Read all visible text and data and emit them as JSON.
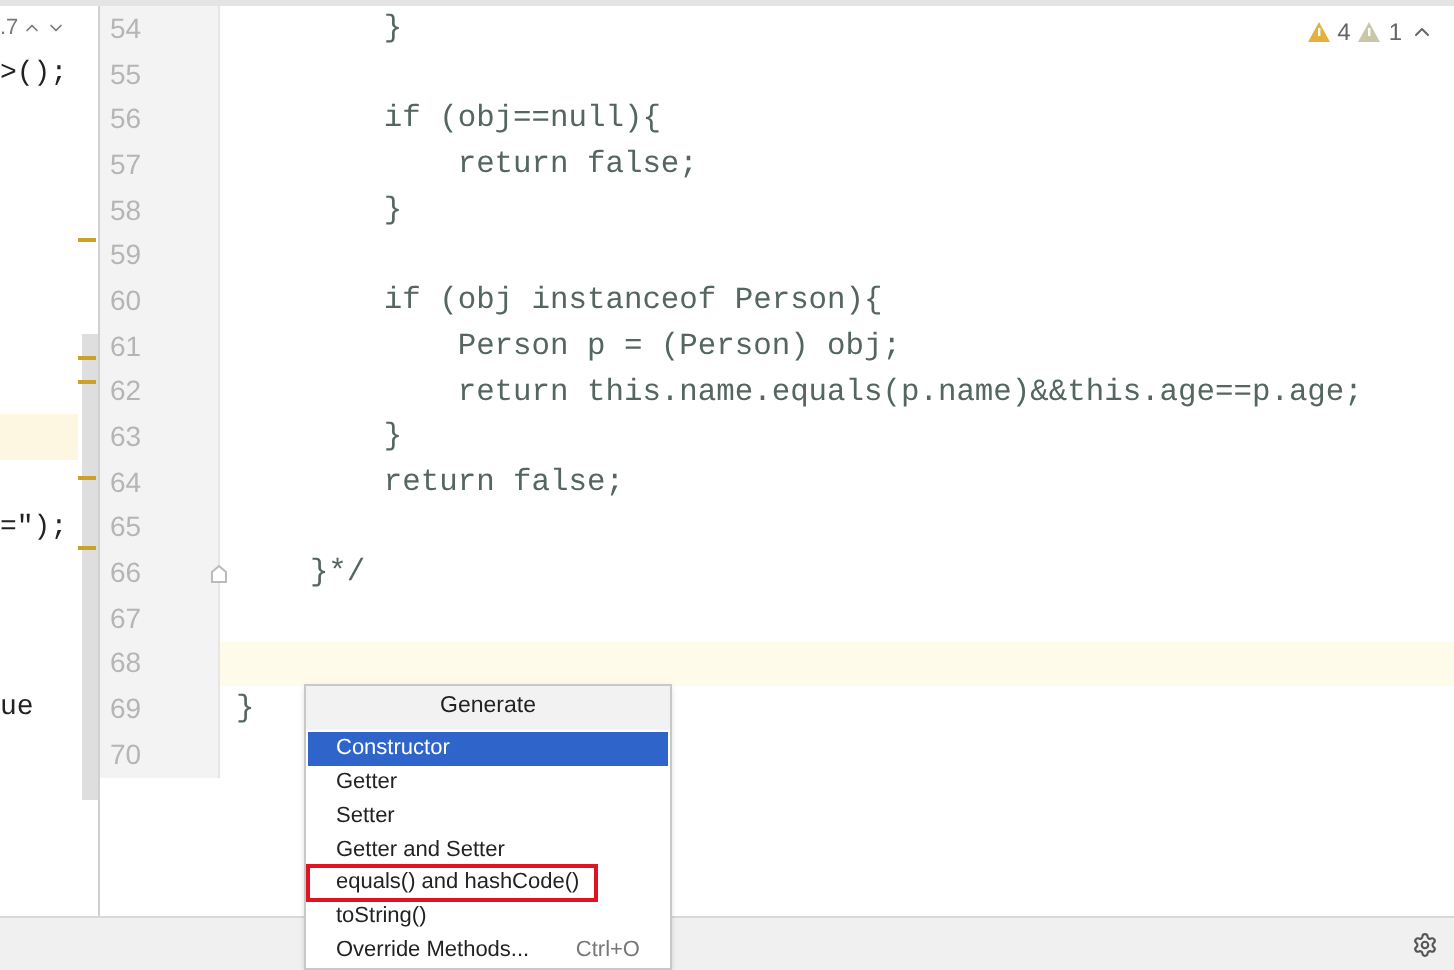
{
  "left_pane": {
    "problem_count": ".7",
    "lines": [
      {
        "text": ">();",
        "current": false
      },
      {
        "current": false
      },
      {
        "current": false
      },
      {
        "current": false
      },
      {
        "current": false
      },
      {
        "current": false
      },
      {
        "current": false
      },
      {
        "current": false
      },
      {
        "current": true
      },
      {
        "current": false
      },
      {
        "text": "=\");",
        "current": false
      },
      {
        "current": false
      },
      {
        "current": false
      },
      {
        "current": false
      },
      {
        "text": "ue",
        "current": false
      },
      {
        "current": false
      }
    ]
  },
  "editor": {
    "warnings": {
      "warning_count": "4",
      "weak_warning_count": "1"
    },
    "lines": [
      {
        "number": "54",
        "code": "        }",
        "current": false
      },
      {
        "number": "55",
        "current": false
      },
      {
        "number": "56",
        "code": "        if (obj==null){",
        "current": false
      },
      {
        "number": "57",
        "code": "            return false;",
        "current": false
      },
      {
        "number": "58",
        "code": "        }",
        "current": false
      },
      {
        "number": "59",
        "current": false
      },
      {
        "number": "60",
        "code": "        if (obj instanceof Person){",
        "current": false
      },
      {
        "number": "61",
        "code": "            Person p = (Person) obj;",
        "current": false
      },
      {
        "number": "62",
        "code": "            return this.name.equals(p.name)&&this.age==p.age;",
        "current": false
      },
      {
        "number": "63",
        "code": "        }",
        "current": false
      },
      {
        "number": "64",
        "code": "        return false;",
        "current": false
      },
      {
        "number": "65",
        "current": false
      },
      {
        "number": "66",
        "code": "    }*/",
        "current": false,
        "fold": true
      },
      {
        "number": "67",
        "current": false
      },
      {
        "number": "68",
        "current": true
      },
      {
        "number": "69",
        "code": "}",
        "current": false
      },
      {
        "number": "70",
        "current": false
      }
    ]
  },
  "generate_popup": {
    "title": "Generate",
    "items": [
      {
        "label": "Constructor",
        "selected": true,
        "annotated": false
      },
      {
        "label": "Getter",
        "selected": false,
        "annotated": false
      },
      {
        "label": "Setter",
        "selected": false,
        "annotated": false
      },
      {
        "label": "Getter and Setter",
        "selected": false,
        "annotated": false
      },
      {
        "label": "equals() and hashCode()",
        "selected": false,
        "annotated": true
      },
      {
        "label": "toString()",
        "selected": false,
        "annotated": false
      },
      {
        "label": "Override Methods...",
        "shortcut": "Ctrl+O",
        "selected": false,
        "annotated": false
      }
    ]
  }
}
